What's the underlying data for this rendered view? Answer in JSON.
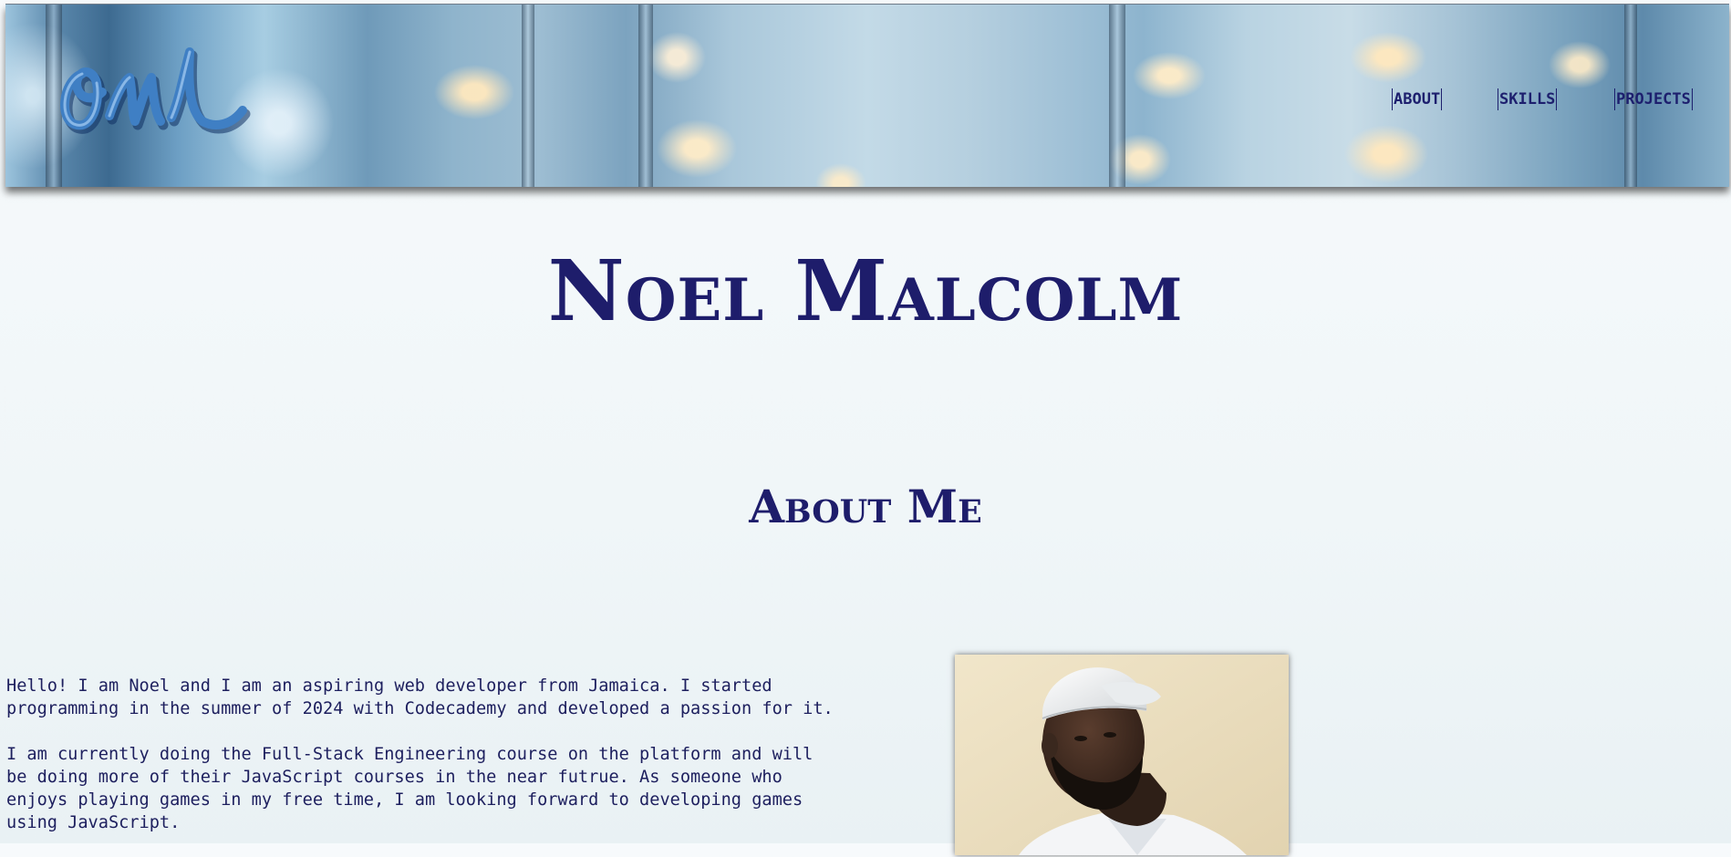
{
  "header": {
    "logo": {
      "icon": "signature-logo-icon",
      "alt": "NM signature logo"
    },
    "nav": [
      {
        "label": "ABOUT"
      },
      {
        "label": "SKILLS"
      },
      {
        "label": "PROJECTS"
      }
    ]
  },
  "hero": {
    "name": "Noel Malcolm"
  },
  "about": {
    "heading": "About Me",
    "paragraphs": [
      "Hello! I am Noel and I am an aspiring web developer from Jamaica. I started\nprogramming in the summer of 2024 with Codecademy and developed a passion for it.",
      "I am currently doing the Full-Stack Engineering course on the platform and will\nbe doing more of their JavaScript courses in the near futrue. As someone who\nenjoys playing games in my free time, I am looking forward to developing games\nusing JavaScript."
    ],
    "photo": {
      "alt": "Portrait of Noel Malcolm wearing a white cap"
    }
  },
  "colors": {
    "primary_text": "#1e1d6b",
    "page_background": "#f3f8fa"
  }
}
